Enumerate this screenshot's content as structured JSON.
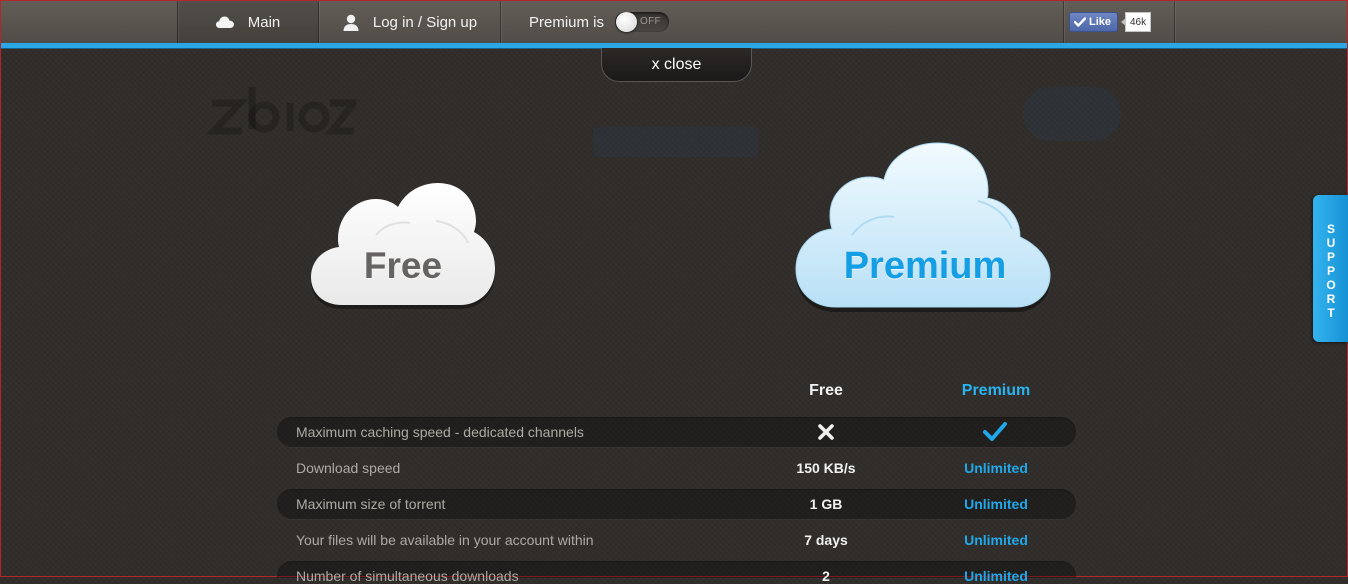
{
  "nav": {
    "main_label": "Main",
    "login_label": "Log in / Sign up",
    "premium_label": "Premium is",
    "premium_toggle_state": "OFF",
    "like_label": "Like",
    "like_count": "46k"
  },
  "close_tab": {
    "label": "x close"
  },
  "clouds": {
    "free_label": "Free",
    "premium_label": "Premium"
  },
  "support": {
    "letters": [
      "S",
      "U",
      "P",
      "P",
      "O",
      "R",
      "T"
    ]
  },
  "comparison": {
    "headers": {
      "free": "Free",
      "premium": "Premium"
    },
    "rows": [
      {
        "label": "Maximum caching speed - dedicated channels",
        "free": "",
        "free_icon": "cross-icon",
        "premium": "",
        "premium_icon": "check-icon"
      },
      {
        "label": "Download speed",
        "free": "150 KB/s",
        "premium": "Unlimited"
      },
      {
        "label": "Maximum size of torrent",
        "free": "1 GB",
        "premium": "Unlimited"
      },
      {
        "label": "Your files will be available in your account within",
        "free": "7 days",
        "premium": "Unlimited"
      },
      {
        "label": "Number of simultaneous downloads",
        "free": "2",
        "premium": "Unlimited"
      }
    ]
  },
  "colors": {
    "accent_blue": "#2aa7e4",
    "premium_text": "#1fa8ea",
    "background": "#302d2a",
    "topbar": "#5a5550"
  }
}
